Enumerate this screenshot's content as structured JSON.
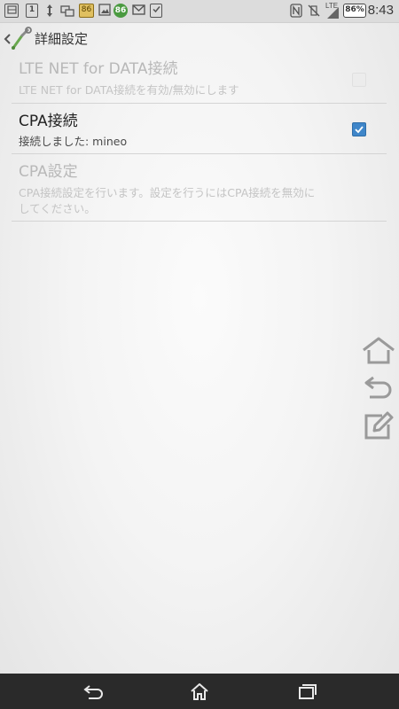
{
  "status_bar": {
    "badge_86_a": "86",
    "badge_86_b": "86",
    "network_label": "LTE",
    "battery": "86%",
    "time": "8:43"
  },
  "action_bar": {
    "title": "詳細設定"
  },
  "preferences": [
    {
      "title": "LTE NET for DATA接続",
      "summary": "LTE NET for DATA接続を有効/無効にします",
      "checked": false,
      "enabled": false
    },
    {
      "title": "CPA接続",
      "summary": "接続しました: mineo",
      "checked": true,
      "enabled": true
    },
    {
      "title": "CPA設定",
      "summary_line1": "CPA接続設定を行います。設定を行うにはCPA接続を無効に",
      "summary_line2": "してください。",
      "enabled": false
    }
  ],
  "floating_buttons": [
    "home-outline-icon",
    "undo-icon",
    "edit-note-icon"
  ],
  "nav_bar": [
    "back-icon",
    "home-icon",
    "recent-apps-icon"
  ],
  "colors": {
    "checkbox_on": "#3f86c9",
    "nav_bar": "#2a2a2a",
    "status_bar": "#dcdcdc"
  }
}
